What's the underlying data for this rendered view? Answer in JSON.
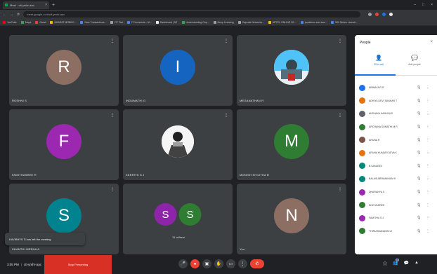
{
  "browser": {
    "tab_title": "Meet - ctt-ymhr-aac",
    "tab_close": "×",
    "new_tab": "+",
    "window_controls": [
      "–",
      "□",
      "×"
    ],
    "nav": [
      "←",
      "→",
      "⟳"
    ],
    "url": "meet.google.com/ctt-ymhr-aac",
    "bookmarks": [
      {
        "label": "YouTube",
        "color": "#ff0000"
      },
      {
        "label": "Maps",
        "color": "#34a853"
      },
      {
        "label": "Gmail",
        "color": "#ea4335"
      },
      {
        "label": "BHARAT MOBILE...",
        "color": "#fbbc04"
      },
      {
        "label": "Nmc Transactions...",
        "color": "#4285f4"
      },
      {
        "label": "RT Test",
        "color": "#9aa0a6"
      },
      {
        "label": "F Dconnects - M...",
        "color": "#4285f4"
      },
      {
        "label": "Dashboard | NT",
        "color": "#e8eaed"
      },
      {
        "label": "Understanding Cap...",
        "color": "#34a853"
      },
      {
        "label": "Deep Learning",
        "color": "#9aa0a6"
      },
      {
        "label": "Capsule Networks...",
        "color": "#9aa0a6"
      },
      {
        "label": "NPTEL ONLINE CE...",
        "color": "#fbbc04"
      },
      {
        "label": "questions and ans...",
        "color": "#4285f4"
      },
      {
        "label": "500 Series Launch...",
        "color": "#4285f4"
      }
    ]
  },
  "tiles": [
    {
      "type": "initial",
      "initial": "R",
      "color": "#8d6e63",
      "label": "ROSHNI S"
    },
    {
      "type": "initial",
      "initial": "I",
      "color": "#1565c0",
      "label": "INDUMATHI G"
    },
    {
      "type": "image",
      "label": "MEGANATHAN R"
    },
    {
      "type": "initial",
      "initial": "F",
      "color": "#9c27b0",
      "label": "FAMITHASREE R"
    },
    {
      "type": "image",
      "label": "KEERTHI S J"
    },
    {
      "type": "initial",
      "initial": "M",
      "color": "#2e7d32",
      "label": "MONISH SHIJITHA R"
    },
    {
      "type": "initial",
      "initial": "S",
      "color": "#00838f",
      "label": "SHANTHI MEENA A"
    },
    {
      "type": "pair",
      "a": "S",
      "a_color": "#8e24aa",
      "b": "S",
      "b_color": "#2e7d32",
      "label": "11 others"
    },
    {
      "type": "initial",
      "initial": "N",
      "color": "#8d6e63",
      "label": "You"
    }
  ],
  "tile_more": "⋮",
  "toast": "KAVIBHYS S has left the meeting",
  "people_panel": {
    "title": "People",
    "close": "×",
    "tabs": [
      {
        "icon": "👤",
        "label": "35 in call"
      },
      {
        "icon": "💬",
        "label": "Add people"
      }
    ],
    "participants": [
      {
        "name": "ABINAYA R S",
        "color": "#1a73e8"
      },
      {
        "name": "ADHIYA DEVI SANKAR T",
        "color": "#e8710a"
      },
      {
        "name": "AKSHAYA KAMLINI S",
        "color": "#5f6368"
      },
      {
        "name": "ARCHANA SUMATHI M R",
        "color": "#2e7d32"
      },
      {
        "name": "ARUNA R",
        "color": "#795548"
      },
      {
        "name": "ARUNA KUMARI DEVA K",
        "color": "#e8710a"
      },
      {
        "name": "B SANJEEV",
        "color": "#00897b"
      },
      {
        "name": "BALASUBRAMANIAM K",
        "color": "#00897b"
      },
      {
        "name": "DHARANYA S",
        "color": "#9c27b0"
      },
      {
        "name": "DHIVYASREE",
        "color": "#2e7d32"
      },
      {
        "name": "FAMITHA S J",
        "color": "#9c27b0"
      },
      {
        "name": "THIRUGNANASELVI",
        "color": "#2e7d32"
      }
    ],
    "mic_icon": "🎙",
    "more_icon": "⋮"
  },
  "bottom": {
    "time": "3:05 PM",
    "separator": "|",
    "meeting_code": "ctt-ymhr-aac",
    "host_button": "Stop Presenting",
    "controls": [
      "🎤",
      "●",
      "▣",
      "✋",
      "▭",
      "⋮",
      "✆"
    ],
    "right_controls": [
      "ⓘ",
      "👥",
      "💬",
      "▲"
    ],
    "people_count": "35"
  }
}
